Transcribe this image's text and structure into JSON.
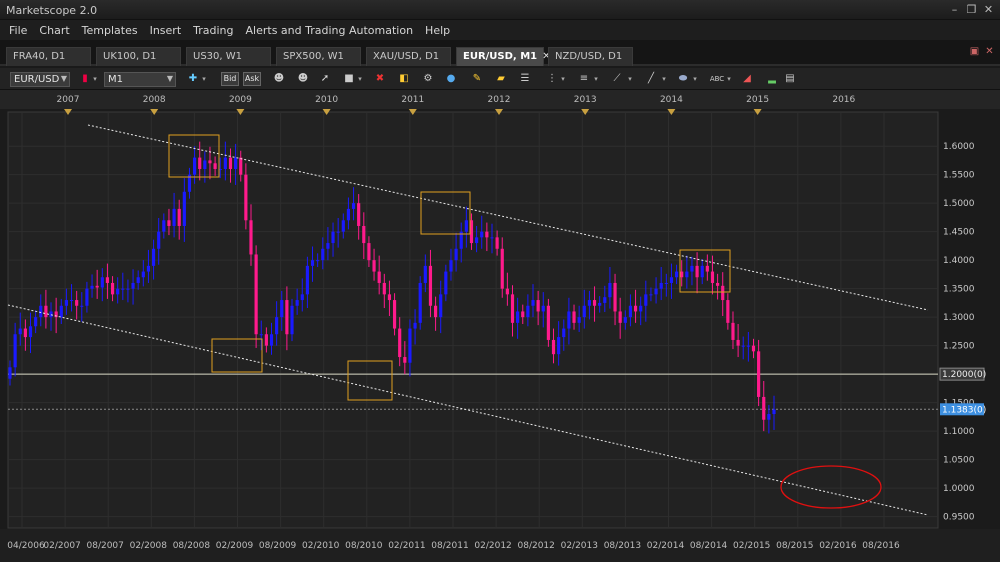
{
  "window": {
    "title": "Marketscope 2.0",
    "minimize": "–",
    "restore": "❐",
    "close": "✕"
  },
  "menu": [
    "File",
    "Chart",
    "Templates",
    "Insert",
    "Trading",
    "Alerts and Trading Automation",
    "Help"
  ],
  "tabs": [
    {
      "label": "FRA40, D1",
      "active": false
    },
    {
      "label": "UK100, D1",
      "active": false
    },
    {
      "label": "US30, W1",
      "active": false
    },
    {
      "label": "SPX500, W1",
      "active": false
    },
    {
      "label": "XAU/USD, D1",
      "active": false
    },
    {
      "label": "EUR/USD, M1",
      "active": true
    },
    {
      "label": "NZD/USD, D1",
      "active": false
    }
  ],
  "tab_close_glyph": "✕",
  "tabbar_controls": {
    "restore": "▣",
    "close": "✕"
  },
  "toolbar": {
    "symbol": "EUR/USD",
    "timeframe": "M1",
    "bid_label": "Bid",
    "ask_label": "Ask",
    "icons": [
      "candle-type-icon",
      "crosshair-icon",
      "person-icon",
      "person-icon",
      "cursor-icon",
      "square-icon",
      "trade-icon",
      "chart-icon",
      "settings-icon",
      "globe-icon",
      "pencil-icon",
      "brush-icon",
      "hlines-icon",
      "vline-icon",
      "fibonacci-icon",
      "trendline-icon",
      "line-icon",
      "ellipse-icon",
      "abc-text-icon",
      "eraser-icon",
      "volume-icon",
      "properties-icon"
    ]
  },
  "chart_data": {
    "type": "candlestick",
    "symbol": "EUR/USD",
    "timeframe": "M1",
    "year_axis": [
      "2007",
      "2008",
      "2009",
      "2010",
      "2011",
      "2012",
      "2013",
      "2014",
      "2015",
      "2016"
    ],
    "x_tick_labels": [
      "04/2006",
      "02/2007",
      "08/2007",
      "02/2008",
      "08/2008",
      "02/2009",
      "08/2009",
      "02/2010",
      "08/2010",
      "02/2011",
      "08/2011",
      "02/2012",
      "08/2012",
      "02/2013",
      "08/2013",
      "02/2014",
      "08/2014",
      "02/2015",
      "08/2015",
      "02/2016",
      "08/2016"
    ],
    "y_tick_labels": [
      "1.6000",
      "1.5500",
      "1.5000",
      "1.4500",
      "1.4000",
      "1.3500",
      "1.3000",
      "1.2500",
      "1.2000",
      "1.1500",
      "1.1000",
      "1.0500",
      "1.0000",
      "0.9500"
    ],
    "ylim": [
      0.93,
      1.66
    ],
    "horizontal_line": {
      "value": 1.2,
      "label": "1.2000(0)"
    },
    "current_price": {
      "value": 1.1383,
      "label": "1.1383(0)"
    },
    "closes": [
      1.212,
      1.27,
      1.28,
      1.265,
      1.284,
      1.3,
      1.32,
      1.3,
      1.31,
      1.3,
      1.32,
      1.33,
      1.33,
      1.32,
      1.32,
      1.35,
      1.355,
      1.352,
      1.37,
      1.36,
      1.34,
      1.35,
      1.35,
      1.35,
      1.36,
      1.37,
      1.38,
      1.39,
      1.42,
      1.45,
      1.47,
      1.46,
      1.49,
      1.46,
      1.52,
      1.55,
      1.58,
      1.56,
      1.575,
      1.57,
      1.56,
      1.56,
      1.58,
      1.56,
      1.58,
      1.55,
      1.47,
      1.41,
      1.27,
      1.27,
      1.25,
      1.27,
      1.3,
      1.33,
      1.27,
      1.32,
      1.33,
      1.34,
      1.39,
      1.4,
      1.4,
      1.42,
      1.43,
      1.45,
      1.45,
      1.47,
      1.49,
      1.5,
      1.46,
      1.43,
      1.4,
      1.38,
      1.36,
      1.34,
      1.33,
      1.28,
      1.23,
      1.22,
      1.28,
      1.29,
      1.36,
      1.39,
      1.32,
      1.3,
      1.34,
      1.38,
      1.4,
      1.42,
      1.45,
      1.47,
      1.43,
      1.44,
      1.45,
      1.44,
      1.44,
      1.42,
      1.35,
      1.34,
      1.29,
      1.31,
      1.3,
      1.32,
      1.33,
      1.31,
      1.32,
      1.26,
      1.235,
      1.265,
      1.28,
      1.31,
      1.29,
      1.3,
      1.32,
      1.33,
      1.32,
      1.325,
      1.335,
      1.36,
      1.31,
      1.29,
      1.3,
      1.32,
      1.31,
      1.32,
      1.34,
      1.34,
      1.35,
      1.36,
      1.36,
      1.37,
      1.38,
      1.37,
      1.38,
      1.39,
      1.37,
      1.39,
      1.38,
      1.36,
      1.355,
      1.33,
      1.29,
      1.26,
      1.25,
      1.25,
      1.25,
      1.24,
      1.16,
      1.12,
      1.13,
      1.138
    ]
  }
}
